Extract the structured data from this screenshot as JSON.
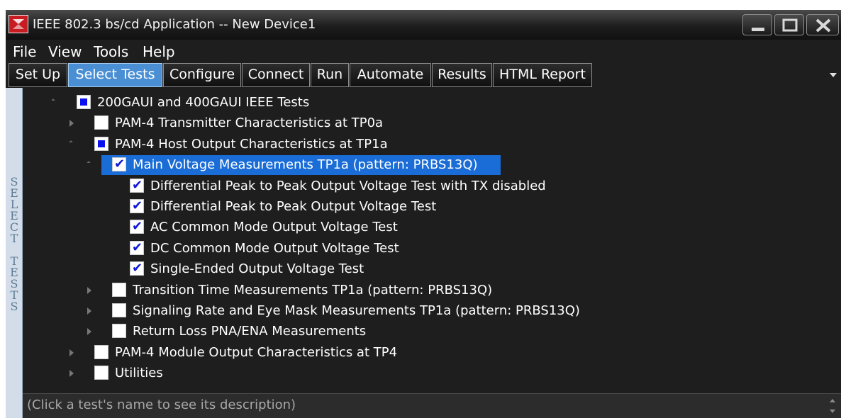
{
  "window": {
    "title": "IEEE 802.3 bs/cd Application -- New Device1"
  },
  "menu": [
    "File",
    "View",
    "Tools",
    "Help"
  ],
  "tabs": [
    "Set Up",
    "Select Tests",
    "Configure",
    "Connect",
    "Run",
    "Automate",
    "Results",
    "HTML Report"
  ],
  "active_tab": "Select Tests",
  "side_label": "SELECT TESTS",
  "tree": [
    {
      "label": "200GAUI and 400GAUI IEEE Tests",
      "level": 0,
      "state": "partial",
      "expander": "expanded"
    },
    {
      "label": "PAM-4 Transmitter Characteristics at TP0a",
      "level": 1,
      "state": "unchecked",
      "expander": "collapsed"
    },
    {
      "label": "PAM-4 Host Output Characteristics at TP1a",
      "level": 1,
      "state": "partial",
      "expander": "expanded"
    },
    {
      "label": "Main Voltage Measurements TP1a (pattern: PRBS13Q)",
      "level": 2,
      "state": "checked",
      "expander": "expanded",
      "selected": true
    },
    {
      "label": "Differential Peak to Peak Output Voltage Test with TX disabled",
      "level": 3,
      "state": "checked",
      "expander": "none"
    },
    {
      "label": "Differential Peak to Peak Output Voltage Test",
      "level": 3,
      "state": "checked",
      "expander": "none"
    },
    {
      "label": "AC Common Mode Output Voltage Test",
      "level": 3,
      "state": "checked",
      "expander": "none"
    },
    {
      "label": "DC Common Mode Output Voltage Test",
      "level": 3,
      "state": "checked",
      "expander": "none"
    },
    {
      "label": "Single-Ended Output Voltage Test",
      "level": 3,
      "state": "checked",
      "expander": "none"
    },
    {
      "label": "Transition Time Measurements TP1a (pattern: PRBS13Q)",
      "level": 2,
      "state": "unchecked",
      "expander": "collapsed"
    },
    {
      "label": "Signaling Rate and Eye Mask Measurements TP1a (pattern: PRBS13Q)",
      "level": 2,
      "state": "unchecked",
      "expander": "collapsed"
    },
    {
      "label": "Return Loss PNA/ENA Measurements",
      "level": 2,
      "state": "unchecked",
      "expander": "collapsed"
    },
    {
      "label": "PAM-4 Module Output Characteristics at TP4",
      "level": 1,
      "state": "unchecked",
      "expander": "collapsed"
    },
    {
      "label": "Utilities",
      "level": 1,
      "state": "unchecked",
      "expander": "collapsed"
    }
  ],
  "description": "(Click a test's name to see its description)",
  "colors": {
    "selection": "#1a6cd6",
    "active_tab": "#4a8fd4",
    "check": "#1118d8",
    "partial": "#0b10ee"
  }
}
